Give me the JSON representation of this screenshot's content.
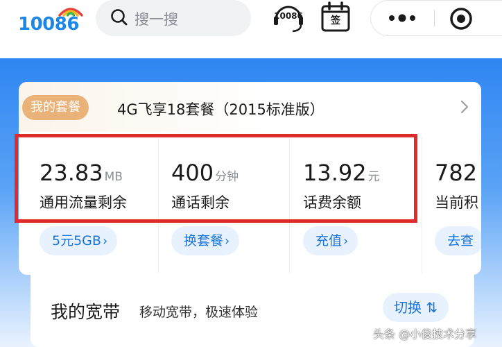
{
  "header": {
    "logo_text": "10086",
    "search_placeholder": "搜一搜",
    "hotline_label": "10086",
    "signin_label": "签",
    "icons": {
      "search": "search-icon",
      "hotline": "headset-icon",
      "signin": "calendar-icon",
      "more": "more-dots-icon",
      "close": "target-close-icon"
    }
  },
  "package": {
    "badge": "我的套餐",
    "name": "4G飞享18套餐（2015标准版）",
    "stats": [
      {
        "value": "23.83",
        "unit": "MB",
        "label": "通用流量剩余",
        "button": "5元5GB"
      },
      {
        "value": "400",
        "unit": "分钟",
        "label": "通话剩余",
        "button": "换套餐"
      },
      {
        "value": "13.92",
        "unit": "元",
        "label": "话费余额",
        "button": "充值"
      },
      {
        "value": "782",
        "unit": "",
        "label": "当前积",
        "button": "去查"
      }
    ]
  },
  "broadband": {
    "title": "我的宽带",
    "description": "移动宽带，极速体验",
    "switch_label": "切换 ⇅"
  },
  "watermark": "头条 @小俊技术分享",
  "colors": {
    "brand_blue": "#1b87e6",
    "badge_gold": "#e9b279",
    "button_text": "#1a73d9",
    "highlight_red": "#e12b2b"
  }
}
